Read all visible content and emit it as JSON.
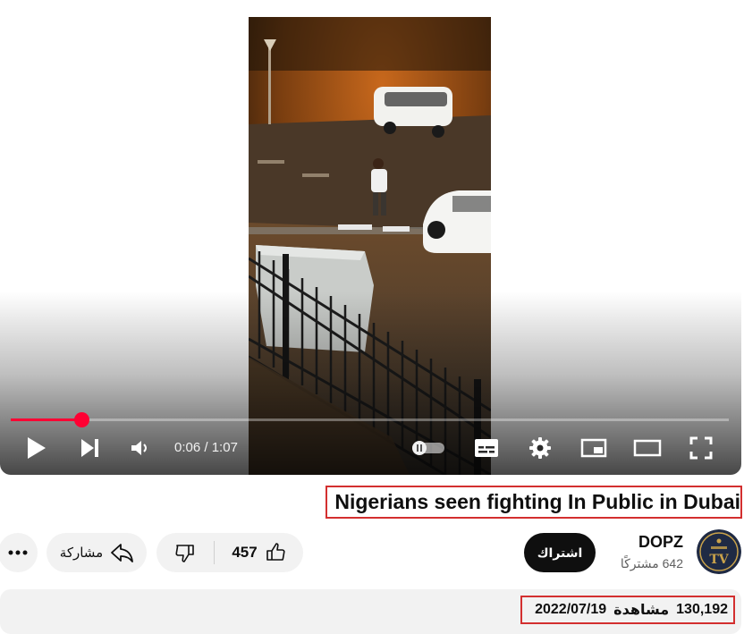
{
  "player": {
    "current_time": "0:06",
    "duration": "1:07",
    "progress_fraction": 0.098,
    "colors": {
      "progress": "#ff0033"
    },
    "controls": [
      "play-icon",
      "next-icon",
      "volume-icon",
      "autoplay-toggle-icon",
      "subtitles-icon",
      "gear-icon",
      "miniplayer-icon",
      "theater-icon",
      "fullscreen-icon"
    ]
  },
  "video": {
    "title": "Nigerians seen fighting In Public in Dubai"
  },
  "channel": {
    "name": "DOPZ",
    "subscribers": "642 مشتركًا",
    "avatar_text": "TV"
  },
  "actions": {
    "subscribe_label": "اشتراك",
    "like_count": "457",
    "share_label": "مشاركة"
  },
  "description": {
    "views": "130,192",
    "views_label": "مشاهدة",
    "date": "2022/07/19"
  }
}
